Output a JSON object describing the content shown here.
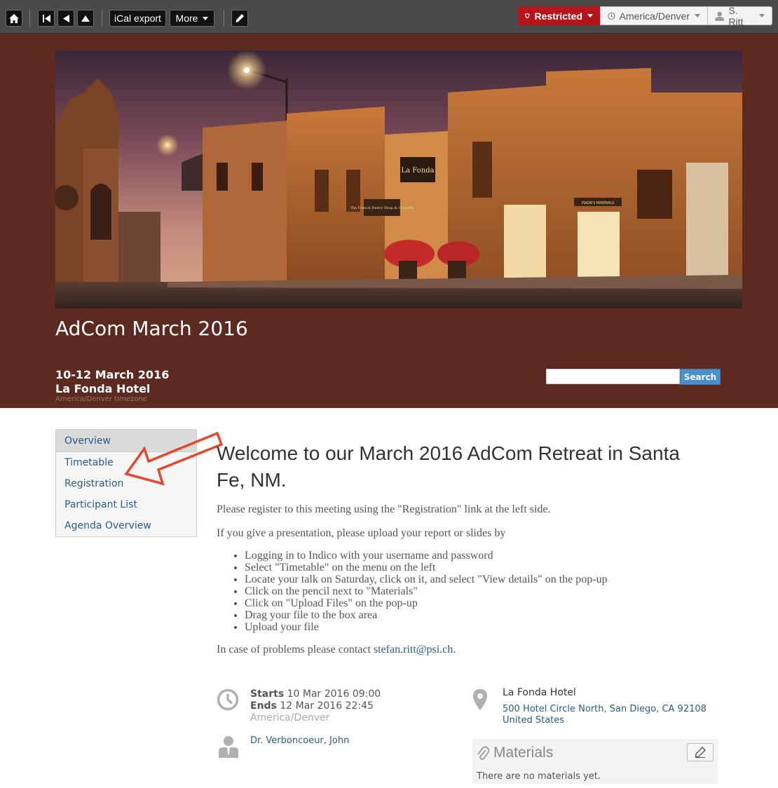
{
  "toolbar": {
    "ical_label": "iCal export",
    "more_label": "More",
    "restricted_label": "Restricted",
    "timezone_label": "America/Denver",
    "user_label": "S. Ritt",
    "icons": [
      "home-icon",
      "first-icon",
      "previous-icon",
      "up-icon",
      "pencil-icon",
      "shield-icon",
      "clock-icon",
      "user-icon"
    ]
  },
  "header": {
    "title": "AdCom March 2016",
    "dates": "10-12 March 2016",
    "venue": "La Fonda Hotel",
    "timezone_note": "America/Denver timezone",
    "search_placeholder": "",
    "search_button": "Search",
    "banner_signs": [
      "La Fonda",
      "The French Pastry Shop & Creperie",
      "PIADA'S MINERALS"
    ]
  },
  "menu": {
    "items": [
      {
        "label": "Overview"
      },
      {
        "label": "Timetable"
      },
      {
        "label": "Registration"
      },
      {
        "label": "Participant List"
      },
      {
        "label": "Agenda Overview"
      }
    ]
  },
  "content": {
    "heading": "Welcome to our March 2016 AdCom Retreat in Santa Fe, NM.",
    "p1": "Please register to this meeting using the \"Registration\" link at the left side.",
    "p2": "If you give a presentation, please upload your report or slides by",
    "steps": [
      "Logging in to Indico with your username and password",
      "Select \"Timetable\" on the menu on the left",
      "Locate your talk on Saturday, click on it, and select \"View details\" on the pop-up",
      "Click on the pencil next to \"Materials\"",
      "Click on \"Upload Files\" on the pop-up",
      "Drag your file to the box area",
      "Upload your file"
    ],
    "p3_prefix": "In case of problems please contact ",
    "p3_email": "stefan.ritt@psi.ch",
    "p3_suffix": "."
  },
  "details": {
    "starts_label": "Starts",
    "starts_value": "10 Mar 2016 09:00",
    "ends_label": "Ends",
    "ends_value": "12 Mar 2016 22:45",
    "timezone": "America/Denver",
    "chair": "Dr. Verboncoeur, John",
    "location_name": "La Fonda Hotel",
    "address_line1": "500 Hotel Circle North, San Diego, CA 92108",
    "address_line2": "United States",
    "materials_title": "Materials",
    "materials_empty": "There are no materials yet."
  },
  "colors": {
    "header_bg": "#5c2a20",
    "restricted": "#b4141a",
    "link": "#2b5b87",
    "search_button": "#4a8fcb",
    "arrow": "#e2492c"
  }
}
